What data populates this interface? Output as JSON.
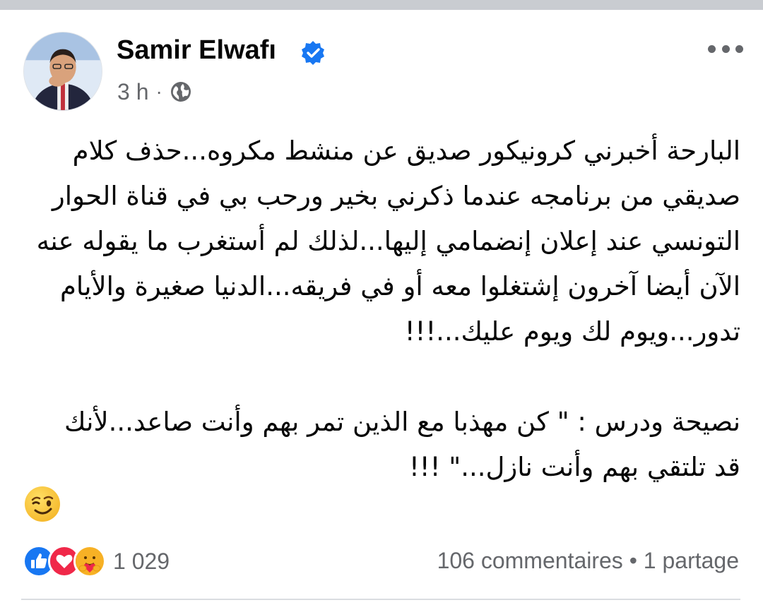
{
  "post": {
    "author": "Samir Elwafı",
    "time": "3 h",
    "separator": "·",
    "privacy_icon": "globe-icon",
    "verified_icon": "verified-badge-icon",
    "more_icon": "more-options-icon",
    "paragraph1": [
      "البارحة أخبرني كرونيكور صديق عن منشط مكروه...حذف كلام",
      "صديقي من برنامجه عندما ذكرني بخير ورحب بي في قناة الحوار",
      "التونسي عند إعلان إنضمامي إليها...لذلك لم أستغرب ما يقوله عنه",
      "الآن أيضا آخرون إشتغلوا معه أو في فريقه...الدنيا صغيرة والأيام",
      "تدور...ويوم لك ويوم عليك...!!!"
    ],
    "paragraph2": [
      "نصيحة ودرس : \" كن مهذبا مع الذين تمر بهم وأنت صاعد...لأنك",
      "قد تلتقي بهم وأنت نازل...\" !!!"
    ],
    "emoji": "winking-face-emoji"
  },
  "footer": {
    "reaction_icons": [
      "like-reaction-icon",
      "love-reaction-icon",
      "care-reaction-icon"
    ],
    "reaction_count": "1 029",
    "comments": "106 commentaires",
    "stats_separator": "•",
    "shares": "1 partage"
  },
  "colors": {
    "verified_blue": "#1877f2",
    "secondary_text": "#65676b",
    "love_red": "#f02849",
    "care_yellow": "#f7b125"
  }
}
